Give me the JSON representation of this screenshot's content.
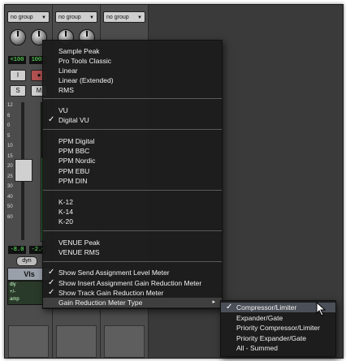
{
  "channel_strips": [
    {
      "group": "no group",
      "pan_left": "<100",
      "pan_right": "100>",
      "button_i": "I",
      "button_s": "S",
      "button_m": "M",
      "scale": [
        "12",
        "6",
        "0",
        "5",
        "10",
        "15",
        "20",
        "25",
        "30",
        "40",
        "50",
        "60"
      ],
      "volume_left": "-8.0",
      "volume_right": "-2.0",
      "dyn": "dyn",
      "name": "Vls",
      "inserts": [
        "dly",
        "+/-",
        "amp"
      ]
    },
    {
      "group": "no group"
    },
    {
      "group": "no group"
    }
  ],
  "menu": {
    "items_group1": [
      "Sample Peak",
      "Pro Tools Classic",
      "Linear",
      "Linear (Extended)",
      "RMS"
    ],
    "items_group2": [
      "VU",
      "Digital VU"
    ],
    "items_group3": [
      "PPM Digital",
      "PPM BBC",
      "PPM Nordic",
      "PPM EBU",
      "PPM DIN"
    ],
    "items_group4": [
      "K-12",
      "K-14",
      "K-20"
    ],
    "items_group5": [
      "VENUE Peak",
      "VENUE RMS"
    ],
    "items_group6": [
      "Show Send Assignment Level Meter",
      "Show Insert Assignment Gain Reduction Meter",
      "Show Track Gain Reduction Meter",
      "Gain Reduction Meter Type"
    ],
    "checkmark": "✓",
    "submenu_arrow": "▸"
  },
  "submenu": {
    "items": [
      "Compressor/Limiter",
      "Expander/Gate",
      "Priority Compressor/Limiter",
      "Priority Expander/Gate",
      "All - Summed"
    ]
  },
  "colors": {
    "menu_bg": "#1c1c1c",
    "highlight": "#4b4f58",
    "meter_green": "#6f6"
  }
}
